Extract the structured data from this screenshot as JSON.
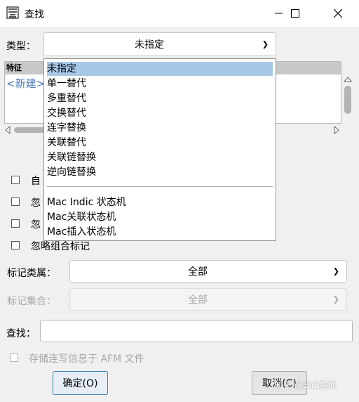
{
  "window": {
    "title": "查找"
  },
  "form": {
    "type_label": "类型：",
    "type_value": "未指定",
    "feature_header": "特征",
    "feature_new": "<新建>",
    "checkboxes": [
      "自",
      "忽",
      "忽",
      "忽略组合标记"
    ],
    "mark_class_label": "标记类属：",
    "mark_class_value": "全部",
    "mark_set_label": "标记集合：",
    "mark_set_value": "全部",
    "search_label": "查找：",
    "search_value": "",
    "store_label": "存储连写信息于  AFM  文件",
    "ok_button": "确定(O)",
    "cancel_button": "取消(C)"
  },
  "dropdown": {
    "items": [
      "未指定",
      "单一替代",
      "多重替代",
      "交换替代",
      "连字替换",
      "关联替代",
      "关联链替换",
      "逆向链替换"
    ],
    "mac_items": [
      "Mac Indic 状态机",
      "Mac关联状态机",
      "Mac插入状态机"
    ],
    "selected": "未指定"
  },
  "watermark": "知乎 @凹凸腰浪"
}
